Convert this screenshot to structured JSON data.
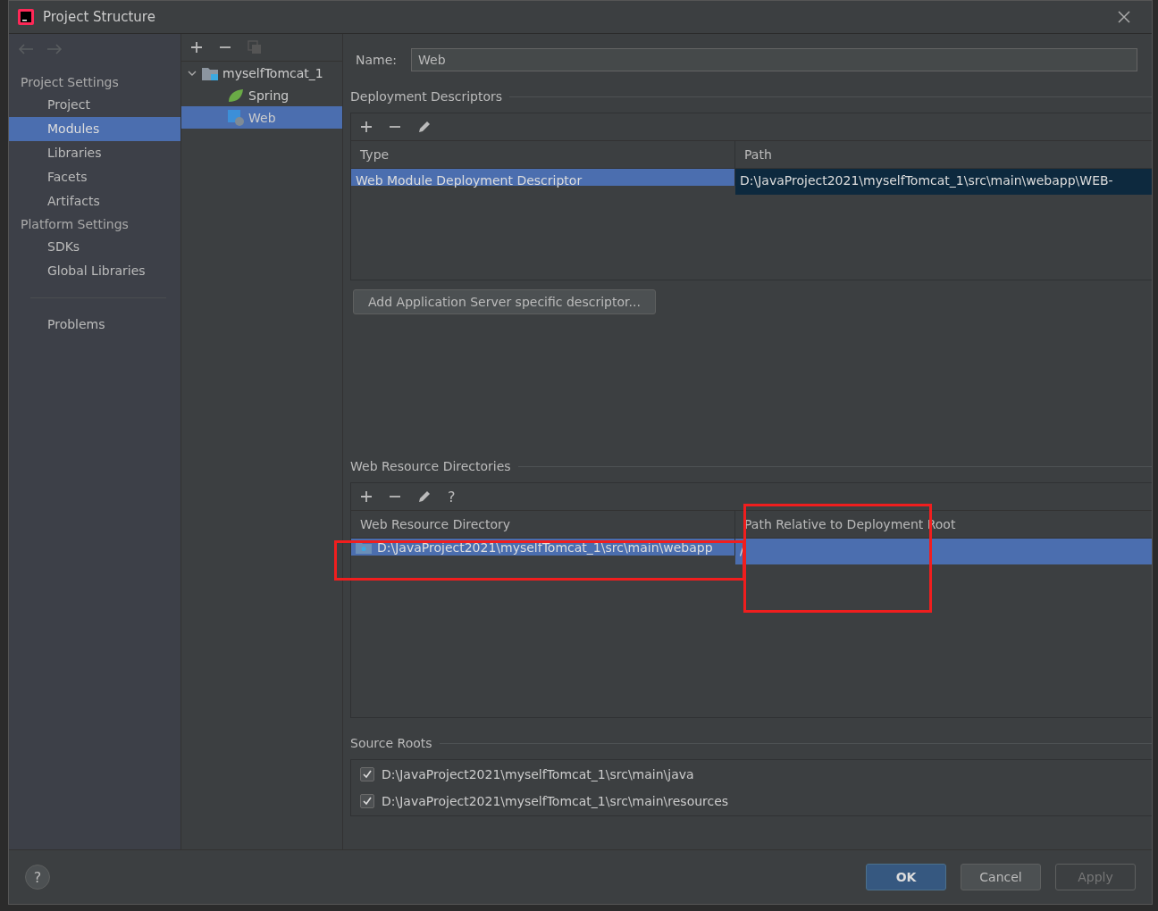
{
  "window": {
    "title": "Project Structure"
  },
  "sidebar": {
    "groups": [
      {
        "heading": "Project Settings",
        "items": [
          {
            "label": "Project",
            "selected": false
          },
          {
            "label": "Modules",
            "selected": true
          },
          {
            "label": "Libraries",
            "selected": false
          },
          {
            "label": "Facets",
            "selected": false
          },
          {
            "label": "Artifacts",
            "selected": false
          }
        ]
      },
      {
        "heading": "Platform Settings",
        "items": [
          {
            "label": "SDKs",
            "selected": false
          },
          {
            "label": "Global Libraries",
            "selected": false
          }
        ]
      }
    ],
    "footer_items": [
      {
        "label": "Problems",
        "selected": false
      }
    ]
  },
  "tree": {
    "items": [
      {
        "label": "myselfTomcat_1",
        "kind": "module",
        "expanded": true,
        "selected": false,
        "children": [
          {
            "label": "Spring",
            "kind": "spring",
            "selected": false
          },
          {
            "label": "Web",
            "kind": "web",
            "selected": true
          }
        ]
      }
    ]
  },
  "name_field": {
    "label": "Name:",
    "value": "Web"
  },
  "deployment_descriptors": {
    "title": "Deployment Descriptors",
    "columns": [
      "Type",
      "Path"
    ],
    "rows": [
      {
        "cells": [
          "Web Module Deployment Descriptor",
          "D:\\JavaProject2021\\myselfTomcat_1\\src\\main\\webapp\\WEB-"
        ],
        "selected": true
      }
    ],
    "button": "Add Application Server specific descriptor..."
  },
  "web_resource_directories": {
    "title": "Web Resource Directories",
    "columns": [
      "Web Resource Directory",
      "Path Relative to Deployment Root"
    ],
    "rows": [
      {
        "cells": [
          "D:\\JavaProject2021\\myselfTomcat_1\\src\\main\\webapp",
          "/"
        ],
        "selected": true
      }
    ],
    "help": "?"
  },
  "source_roots": {
    "title": "Source Roots",
    "items": [
      {
        "label": "D:\\JavaProject2021\\myselfTomcat_1\\src\\main\\java",
        "checked": true
      },
      {
        "label": "D:\\JavaProject2021\\myselfTomcat_1\\src\\main\\resources",
        "checked": true
      }
    ]
  },
  "help_button": "?",
  "buttons": [
    {
      "label": "OK",
      "kind": "primary",
      "disabled": false
    },
    {
      "label": "Cancel",
      "kind": "normal",
      "disabled": false
    },
    {
      "label": "Apply",
      "kind": "normal",
      "disabled": true
    }
  ]
}
